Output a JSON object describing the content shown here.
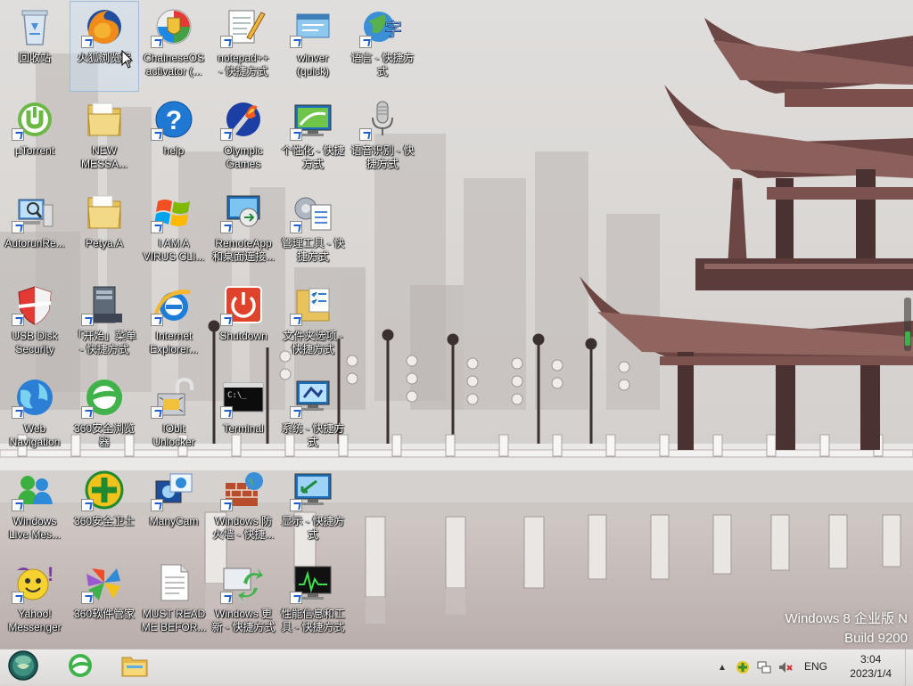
{
  "desktop": {
    "icons": [
      {
        "label": "回收站",
        "icon": "recycle-bin-icon",
        "col": 0,
        "row": 0,
        "shortcut": false
      },
      {
        "label": "火狐浏览器",
        "icon": "firefox-icon",
        "col": 1,
        "row": 0,
        "shortcut": true,
        "selected": true
      },
      {
        "label": "ChaineseOS\nactivator (...",
        "icon": "activator-shield-icon",
        "col": 2,
        "row": 0,
        "shortcut": true
      },
      {
        "label": "notepad++\n- 快捷方式",
        "icon": "notepad-icon",
        "col": 3,
        "row": 0,
        "shortcut": true
      },
      {
        "label": "winver\n(quick)",
        "icon": "winver-window-icon",
        "col": 4,
        "row": 0,
        "shortcut": true
      },
      {
        "label": "语言 - 快捷方\n式",
        "icon": "language-globe-icon",
        "col": 5,
        "row": 0,
        "shortcut": true
      },
      {
        "label": "µTorrent",
        "icon": "utorrent-icon",
        "col": 0,
        "row": 1,
        "shortcut": true
      },
      {
        "label": "NEW\nMESSA...",
        "icon": "folder-icon",
        "col": 1,
        "row": 1,
        "shortcut": false
      },
      {
        "label": "help",
        "icon": "help-icon",
        "col": 2,
        "row": 1,
        "shortcut": true
      },
      {
        "label": "Olympic\nGames",
        "icon": "olympic-torch-icon",
        "col": 3,
        "row": 1,
        "shortcut": true
      },
      {
        "label": "个性化 - 快捷\n方式",
        "icon": "personalize-monitor-icon",
        "col": 4,
        "row": 1,
        "shortcut": true
      },
      {
        "label": "语音识别 - 快\n捷方式",
        "icon": "microphone-icon",
        "col": 5,
        "row": 1,
        "shortcut": true
      },
      {
        "label": "AutorunRe...",
        "icon": "autorun-computer-icon",
        "col": 0,
        "row": 2,
        "shortcut": true
      },
      {
        "label": "Petya.A",
        "icon": "folder-icon",
        "col": 1,
        "row": 2,
        "shortcut": false
      },
      {
        "label": "I AM A\nVIRUS CLI...",
        "icon": "windows-flag-icon",
        "col": 2,
        "row": 2,
        "shortcut": true
      },
      {
        "label": "RemoteApp\n和桌面连接...",
        "icon": "remote-desktop-icon",
        "col": 3,
        "row": 2,
        "shortcut": true
      },
      {
        "label": "管理工具 - 快\n捷方式",
        "icon": "admin-tools-icon",
        "col": 4,
        "row": 2,
        "shortcut": true
      },
      {
        "label": "USB Disk\nSecurity",
        "icon": "usb-shield-icon",
        "col": 0,
        "row": 3,
        "shortcut": true
      },
      {
        "label": "「开始」菜单\n- 快捷方式",
        "icon": "start-menu-tower-icon",
        "col": 1,
        "row": 3,
        "shortcut": true
      },
      {
        "label": "Internet\nExplorer...",
        "icon": "internet-explorer-icon",
        "col": 2,
        "row": 3,
        "shortcut": true
      },
      {
        "label": "Shutdown",
        "icon": "power-icon",
        "col": 3,
        "row": 3,
        "shortcut": true
      },
      {
        "label": "文件夹选项 -\n快捷方式",
        "icon": "folder-options-icon",
        "col": 4,
        "row": 3,
        "shortcut": true
      },
      {
        "label": "Web\nNavigation",
        "icon": "web-globe-icon",
        "col": 0,
        "row": 4,
        "shortcut": true
      },
      {
        "label": "360安全浏览\n器",
        "icon": "360-browser-icon",
        "col": 1,
        "row": 4,
        "shortcut": true
      },
      {
        "label": "IObit\nUnlocker",
        "icon": "unlock-icon",
        "col": 2,
        "row": 4,
        "shortcut": true
      },
      {
        "label": "Terminal",
        "icon": "terminal-icon",
        "col": 3,
        "row": 4,
        "shortcut": true
      },
      {
        "label": "系统 - 快捷方\n式",
        "icon": "system-monitor-icon",
        "col": 4,
        "row": 4,
        "shortcut": true
      },
      {
        "label": "Windows\nLive Mes...",
        "icon": "messenger-people-icon",
        "col": 0,
        "row": 5,
        "shortcut": true
      },
      {
        "label": "360安全卫士",
        "icon": "360-security-icon",
        "col": 1,
        "row": 5,
        "shortcut": true
      },
      {
        "label": "ManyCam",
        "icon": "manycam-icon",
        "col": 2,
        "row": 5,
        "shortcut": true
      },
      {
        "label": "Windows 防\n火墙 - 快捷...",
        "icon": "firewall-icon",
        "col": 3,
        "row": 5,
        "shortcut": true
      },
      {
        "label": "显示 - 快捷方\n式",
        "icon": "display-monitor-icon",
        "col": 4,
        "row": 5,
        "shortcut": true
      },
      {
        "label": "Yahoo!\nMessenger",
        "icon": "yahoo-messenger-icon",
        "col": 0,
        "row": 6,
        "shortcut": true
      },
      {
        "label": "360软件管家",
        "icon": "360-software-icon",
        "col": 1,
        "row": 6,
        "shortcut": true
      },
      {
        "label": "MUST READ\nME BEFOR...",
        "icon": "text-document-icon",
        "col": 2,
        "row": 6,
        "shortcut": false
      },
      {
        "label": "Windows 更\n新 - 快捷方式",
        "icon": "windows-update-icon",
        "col": 3,
        "row": 6,
        "shortcut": true
      },
      {
        "label": "性能信息和工\n具 - 快捷方式",
        "icon": "performance-icon",
        "col": 4,
        "row": 6,
        "shortcut": true
      }
    ]
  },
  "watermark": {
    "edition": "Windows 8 企业版 N",
    "build": "Build 9200"
  },
  "taskbar": {
    "start_icon": "start-orb-icon",
    "pinned": [
      {
        "name": "360-browser-taskbar-icon"
      },
      {
        "name": "file-explorer-taskbar-icon"
      }
    ],
    "tray": {
      "language": "ENG",
      "time": "3:04",
      "date": "2023/1/4"
    }
  },
  "colors": {
    "sky": "#d8d5d2",
    "roof": "#7a4f4c",
    "bridge": "#e8e6e4",
    "water": "#c7bfbd",
    "taskbar": "#e4e2e0"
  }
}
